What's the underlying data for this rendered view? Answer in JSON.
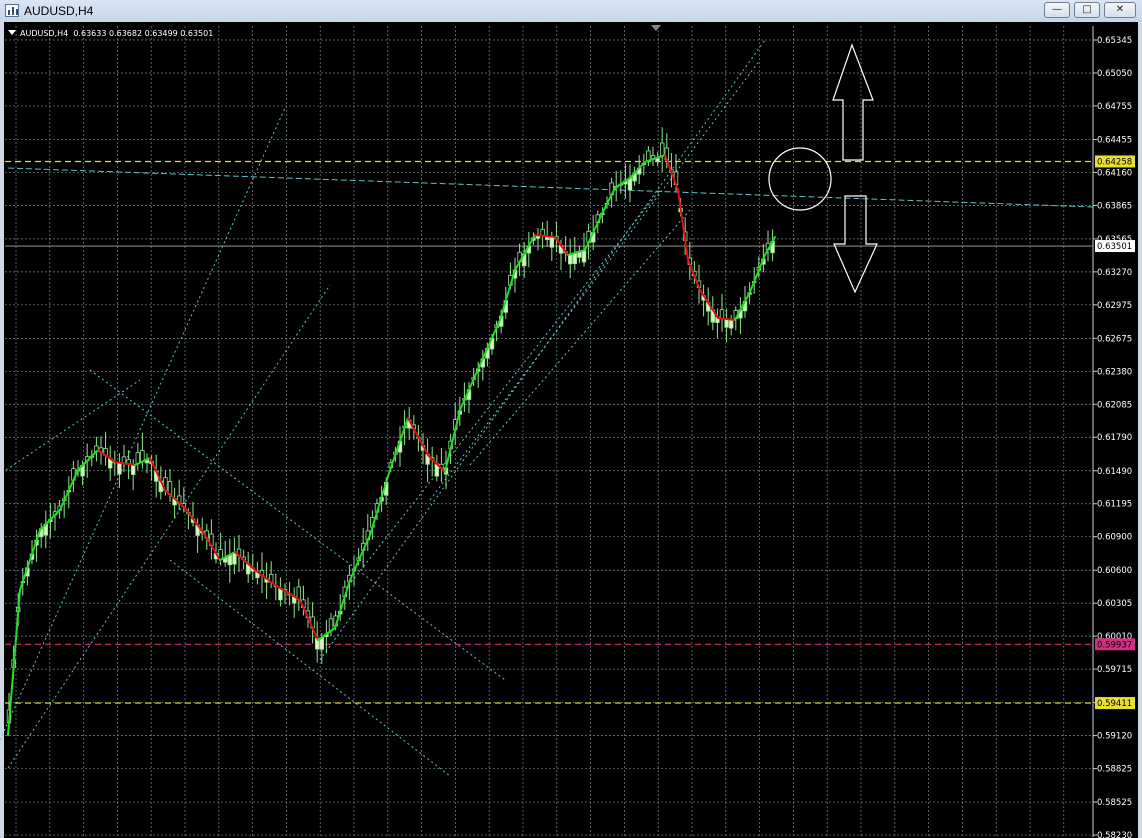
{
  "window": {
    "title": "AUDUSD,H4",
    "minimize_glyph": "—",
    "maximize_glyph": "□",
    "close_glyph": "✕"
  },
  "chart": {
    "symbol": "AUDUSD",
    "timeframe": "H4",
    "ohlc_text": "0.63633 0.63682 0.63499 0.63501",
    "colors": {
      "background": "#000000",
      "grid": "#7a8a8a",
      "bull_candle": "#d8f5c0",
      "bear_candle": "#000000",
      "wick": "#8fe88f",
      "ma_up": "#22dd22",
      "ma_down": "#dd1111",
      "trendline": "#5fc4c4",
      "level_yellow": "#e8e030",
      "level_magenta": "#d03080",
      "price_label_current_bg": "#ffffff"
    },
    "price_scale": [
      "0.65345",
      "0.65050",
      "0.64755",
      "0.64455",
      "0.64160",
      "0.63865",
      "0.63565",
      "0.63270",
      "0.62975",
      "0.62675",
      "0.62380",
      "0.62085",
      "0.61790",
      "0.61490",
      "0.61195",
      "0.60900",
      "0.60600",
      "0.60305",
      "0.60010",
      "0.59715",
      "0.59415",
      "0.59120",
      "0.58825",
      "0.58525",
      "0.58230"
    ],
    "levels": [
      {
        "price": 0.64258,
        "label": "0.64258",
        "color": "#e8e030"
      },
      {
        "price": 0.59937,
        "label": "0.59937",
        "color": "#d03080"
      },
      {
        "price": 0.59411,
        "label": "0.59411",
        "color": "#e8e030"
      }
    ],
    "current_price": {
      "price": 0.63501,
      "label": "0.63501"
    },
    "annotations": [
      {
        "type": "arrow",
        "direction": "up",
        "color": "#ffffff"
      },
      {
        "type": "arrow",
        "direction": "down",
        "color": "#ffffff"
      },
      {
        "type": "ellipse",
        "color": "#ffffff"
      }
    ]
  }
}
